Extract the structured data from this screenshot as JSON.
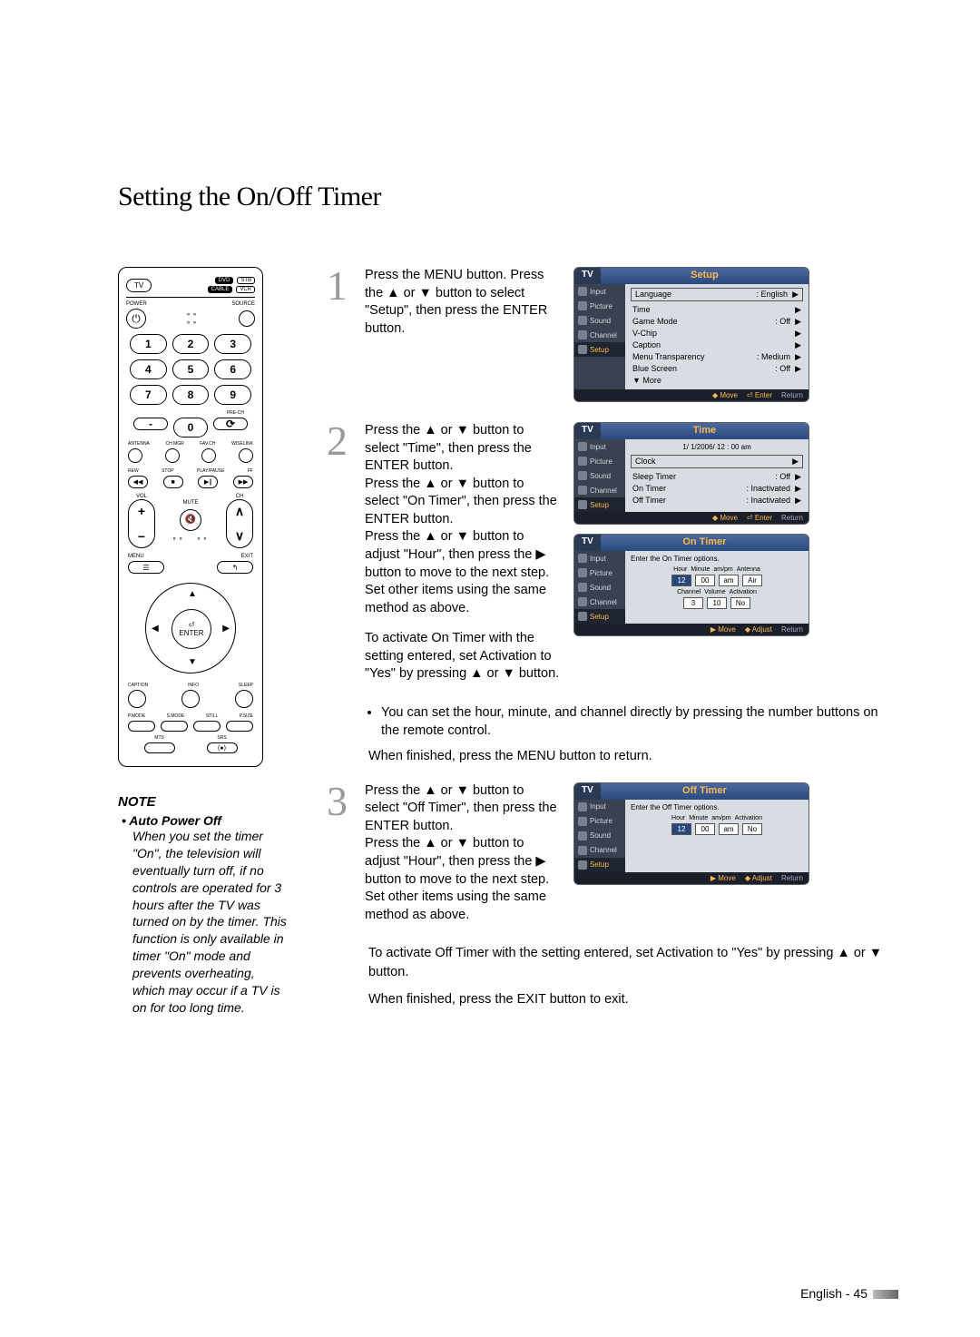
{
  "title": "Setting the On/Off Timer",
  "remote": {
    "tv": "TV",
    "dvd": "DVD",
    "stb": "STB",
    "cable": "CABLE",
    "vcr": "VCR",
    "power": "POWER",
    "source": "SOURCE",
    "nums": [
      "1",
      "2",
      "3",
      "4",
      "5",
      "6",
      "7",
      "8",
      "9",
      "-",
      "0"
    ],
    "prech": "PRE-CH",
    "antenna": "ANTENNA",
    "chmgr": "CH MGR",
    "favch": "FAV.CH",
    "wiselink": "WISELINK",
    "rew": "REW",
    "stop": "STOP",
    "play": "PLAY/PAUSE",
    "ff": "FF",
    "vol": "VOL",
    "ch": "CH",
    "mute": "MUTE",
    "menu": "MENU",
    "exit": "EXIT",
    "enter": "ENTER",
    "caption": "CAPTION",
    "info": "INFO",
    "sleep": "SLEEP",
    "pmode": "P.MODE",
    "smode": "S.MODE",
    "still": "STILL",
    "psize": "P.SIZE",
    "mts": "MTS",
    "srs": "SRS"
  },
  "note": {
    "heading": "NOTE",
    "sub": "• Auto Power Off",
    "body": "When you set the timer \"On\", the television will eventually turn off, if no controls are operated for 3 hours after the TV was turned on by the timer. This function is only available in timer \"On\" mode and prevents overheating, which may occur if a TV is on for too long time."
  },
  "steps": {
    "s1": {
      "num": "1",
      "text": "Press the MENU button. Press the ▲ or ▼ button to select \"Setup\", then press the ENTER button."
    },
    "s2": {
      "num": "2",
      "text": "Press the ▲ or ▼ button to select \"Time\", then press the ENTER button.\nPress the ▲ or ▼ button to select \"On Timer\", then press the ENTER button.\nPress the ▲ or ▼ button to adjust \"Hour\", then press the ▶ button to move to the next step.\nSet other items using the same method as above.",
      "extra": "To activate On Timer with the setting entered, set Activation to \"Yes\" by pressing ▲ or ▼ button."
    },
    "bullet1": "You can set the hour, minute, and channel directly by pressing the number buttons on the remote control.",
    "bullet2": "When finished, press the MENU button to return.",
    "s3": {
      "num": "3",
      "text": "Press the ▲ or ▼ button to select \"Off Timer\", then press the ENTER button.\nPress the ▲ or ▼ button to adjust \"Hour\", then press the ▶ button to move to the next step. Set other items using the same method as above."
    },
    "s3extra1": "To activate Off Timer with the setting entered, set Activation to \"Yes\" by pressing ▲ or ▼ button.",
    "s3extra2": "When finished, press the EXIT button to exit."
  },
  "osd": {
    "tv": "TV",
    "nav": [
      "Input",
      "Picture",
      "Sound",
      "Channel",
      "Setup"
    ],
    "foot_move": "Move",
    "foot_enter": "Enter",
    "foot_return": "Return",
    "foot_adjust": "Adjust",
    "setup": {
      "title": "Setup",
      "rows": [
        {
          "k": "Language",
          "v": ": English"
        },
        {
          "k": "Time",
          "v": ""
        },
        {
          "k": "Game Mode",
          "v": ": Off"
        },
        {
          "k": "V-Chip",
          "v": ""
        },
        {
          "k": "Caption",
          "v": ""
        },
        {
          "k": "Menu Transparency",
          "v": ": Medium"
        },
        {
          "k": "Blue Screen",
          "v": ": Off"
        },
        {
          "k": "▼ More",
          "v": ""
        }
      ]
    },
    "time": {
      "title": "Time",
      "clock": "1/  1/2006/ 12 : 00 am",
      "rows": [
        {
          "k": "Clock",
          "v": ""
        },
        {
          "k": "Sleep Timer",
          "v": ": Off"
        },
        {
          "k": "On Timer",
          "v": ": Inactivated"
        },
        {
          "k": "Off Timer",
          "v": ": Inactivated"
        }
      ]
    },
    "ontimer": {
      "title": "On Timer",
      "hint": "Enter the On Timer options.",
      "hdr1": [
        "Hour",
        "Minute",
        "am/pm",
        "Antenna"
      ],
      "val1": [
        "12",
        "00",
        "am",
        "Air"
      ],
      "hdr2": [
        "Channel",
        "Volume",
        "Activation"
      ],
      "val2": [
        "3",
        "10",
        "No"
      ]
    },
    "offtimer": {
      "title": "Off Timer",
      "hint": "Enter the Off Timer options.",
      "hdr": [
        "Hour",
        "Minute",
        "am/pm",
        "Activation"
      ],
      "val": [
        "12",
        "00",
        "am",
        "No"
      ]
    }
  },
  "footer": "English - 45"
}
